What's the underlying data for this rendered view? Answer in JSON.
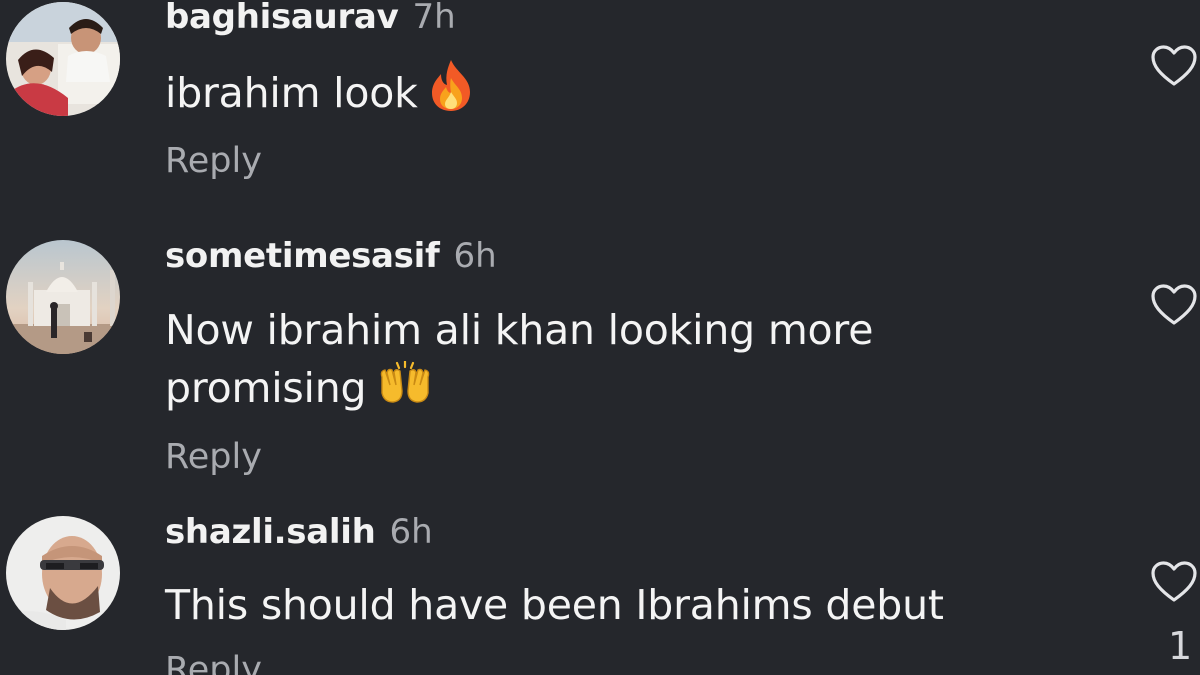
{
  "comments": [
    {
      "username": "baghisaurav",
      "time": "7h",
      "text": "ibrahim look",
      "emoji": "fire-emoji",
      "reply_label": "Reply",
      "like_count": ""
    },
    {
      "username": "sometimesasif",
      "time": "6h",
      "text_line1": "Now ibrahim ali khan looking more",
      "text_line2": "promising",
      "emoji": "raising-hands-emoji",
      "reply_label": "Reply",
      "like_count": ""
    },
    {
      "username": "shazli.salih",
      "time": "6h",
      "text": "This should have been Ibrahims debut",
      "reply_label": "Reply",
      "like_count": "1"
    }
  ],
  "colors": {
    "background": "#25272c",
    "username": "#f2f2f2",
    "secondary": "#a9abb0",
    "text": "#f4f4f4"
  }
}
